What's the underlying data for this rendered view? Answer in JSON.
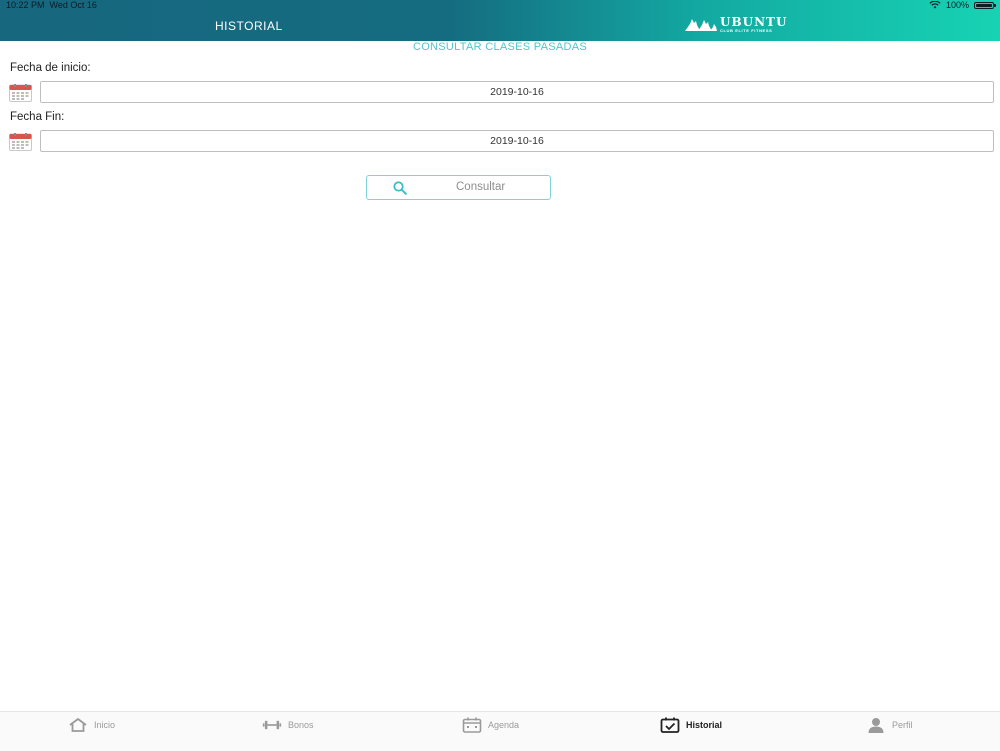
{
  "status_bar": {
    "time": "10:22 PM",
    "date": "Wed Oct 16",
    "battery": "100%"
  },
  "header": {
    "title": "HISTORIAL",
    "brand_name": "UBUNTU",
    "brand_subtitle": "CLUB ELITE FITNESS"
  },
  "section_title": "CONSULTAR CLASES PASADAS",
  "start_date": {
    "label": "Fecha de inicio:",
    "value": "2019-10-16"
  },
  "end_date": {
    "label": "Fecha Fin:",
    "value": "2019-10-16"
  },
  "consult_button": {
    "label": "Consultar",
    "icon": "search-icon"
  },
  "tabs": [
    {
      "label": "Inicio",
      "icon": "home-icon",
      "active": false
    },
    {
      "label": "Bonos",
      "icon": "dumbbell-icon",
      "active": false
    },
    {
      "label": "Agenda",
      "icon": "calendar-icon",
      "active": false
    },
    {
      "label": "Historial",
      "icon": "calendar-check-icon",
      "active": true
    },
    {
      "label": "Perfil",
      "icon": "user-icon",
      "active": false
    }
  ],
  "colors": {
    "header_start": "#17677f",
    "header_end": "#17d3b3",
    "accent": "#4fc7cc",
    "calendar_red": "#d9534f"
  }
}
